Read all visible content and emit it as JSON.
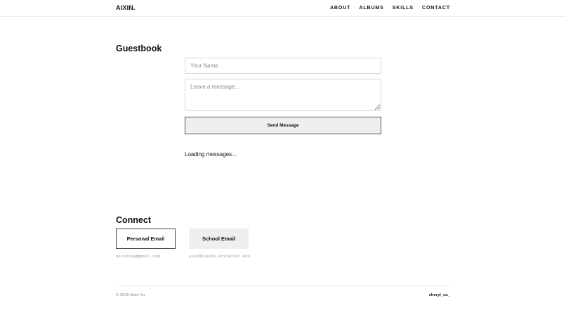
{
  "header": {
    "logo": "AIXIN.",
    "nav": [
      {
        "label": "ABOUT"
      },
      {
        "label": "ALBUMS"
      },
      {
        "label": "SKILLS"
      },
      {
        "label": "CONTACT"
      }
    ]
  },
  "guestbook": {
    "title": "Guestbook",
    "name_placeholder": "Your Name",
    "name_value": "",
    "message_placeholder": "Leave a message...",
    "message_value": "",
    "send_label": "Send Message",
    "status": "Loading messages..."
  },
  "connect": {
    "title": "Connect",
    "cards": [
      {
        "label": "Personal Email",
        "email": "aixinxu0@gmail.com"
      },
      {
        "label": "School Email",
        "email": "axu2@inside.artcenter.edu"
      }
    ]
  },
  "footer": {
    "copyright": "© 2026 Aixin Xu",
    "handle": "cheryl_xu_"
  }
}
